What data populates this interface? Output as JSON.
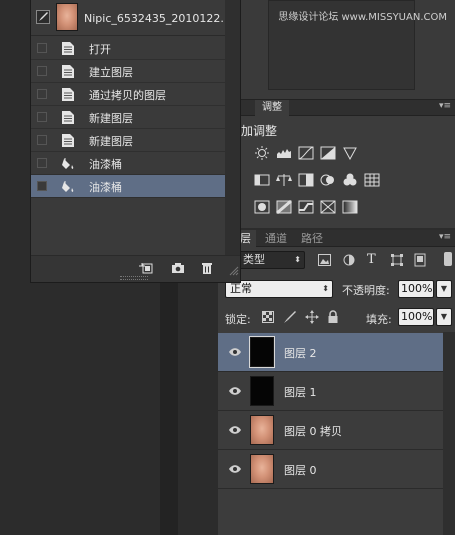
{
  "watermark": "思缘设计论坛 www.MISSYUAN.COM",
  "colors": {
    "selected_row": "#5f6e86",
    "panel_bg": "#3c3c3c",
    "dropdown_bg": "#ededed"
  },
  "history": {
    "snapshot_name": "Nipic_6532435_2010122...",
    "items": [
      {
        "label": "打开",
        "icon": "document-icon",
        "selected": false
      },
      {
        "label": "建立图层",
        "icon": "document-icon",
        "selected": false
      },
      {
        "label": "通过拷贝的图层",
        "icon": "document-icon",
        "selected": false
      },
      {
        "label": "新建图层",
        "icon": "document-icon",
        "selected": false
      },
      {
        "label": "新建图层",
        "icon": "document-icon",
        "selected": false
      },
      {
        "label": "油漆桶",
        "icon": "paint-bucket-icon",
        "selected": false
      },
      {
        "label": "油漆桶",
        "icon": "paint-bucket-icon",
        "selected": true
      }
    ]
  },
  "adjustments": {
    "tab": "调整",
    "title": "加调整"
  },
  "layers": {
    "tabs": [
      "层",
      "通道",
      "路径"
    ],
    "filter_kind": "类型",
    "blend_mode": "正常",
    "opacity_label": "不透明度:",
    "opacity_value": "100%",
    "lock_label": "锁定:",
    "fill_label": "填充:",
    "fill_value": "100%",
    "items": [
      {
        "name": "图层 2",
        "thumb": "black",
        "selected": true
      },
      {
        "name": "图层 1",
        "thumb": "black",
        "selected": false
      },
      {
        "name": "图层 0 拷贝",
        "thumb": "face",
        "selected": false
      },
      {
        "name": "图层 0",
        "thumb": "face",
        "selected": false
      }
    ]
  }
}
